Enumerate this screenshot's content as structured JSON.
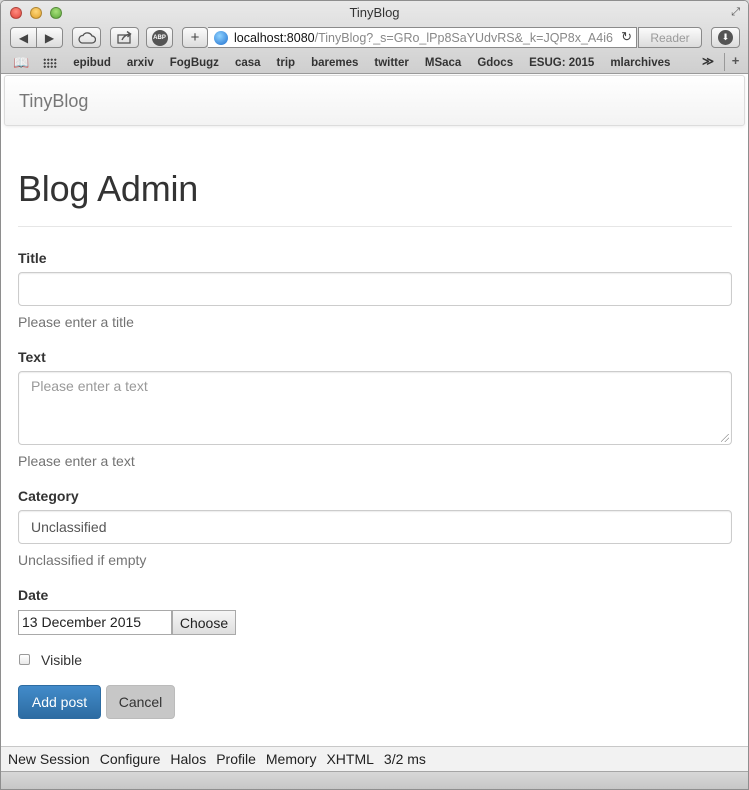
{
  "window": {
    "title": "TinyBlog"
  },
  "toolbar": {
    "url_host": "localhost:8080",
    "url_path": "/TinyBlog?_s=GRo_lPp8SaYUdvRS&_k=JQP8x_A4i6",
    "reader_label": "Reader"
  },
  "bookmarks": {
    "items": [
      "epibud",
      "arxiv",
      "FogBugz",
      "casa",
      "trip",
      "baremes",
      "twitter",
      "MSaca",
      "Gdocs",
      "ESUG: 2015",
      "mlarchives"
    ],
    "more": "≫"
  },
  "navbar": {
    "brand": "TinyBlog"
  },
  "page": {
    "title": "Blog Admin"
  },
  "form": {
    "title_label": "Title",
    "title_value": "",
    "title_help": "Please enter a title",
    "text_label": "Text",
    "text_placeholder": "Please enter a text",
    "text_help": "Please enter a text",
    "category_label": "Category",
    "category_value": "Unclassified",
    "category_help": "Unclassified if empty",
    "date_label": "Date",
    "date_value": "13 December 2015",
    "choose_label": "Choose",
    "visible_label": "Visible",
    "visible_checked": false,
    "submit_label": "Add post",
    "cancel_label": "Cancel"
  },
  "devbar": {
    "items": [
      "New Session",
      "Configure",
      "Halos",
      "Profile",
      "Memory",
      "XHTML"
    ],
    "timing": "3/2 ms"
  },
  "icons": {
    "back": "back-arrow-icon",
    "forward": "forward-arrow-icon",
    "cloud": "cloud-icon",
    "share": "share-icon",
    "adblock": "abp-icon",
    "add": "plus-icon",
    "reload": "reload-icon",
    "download": "download-icon",
    "reading_list": "book-icon",
    "top_sites": "grid-icon"
  },
  "colors": {
    "primary": "#428bca",
    "help_text": "#737373",
    "heading": "#333333"
  }
}
